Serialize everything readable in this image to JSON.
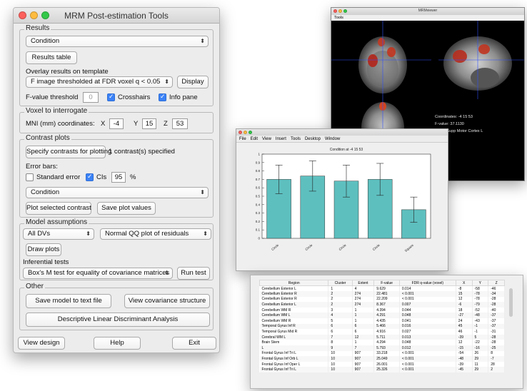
{
  "main": {
    "title": "MRM Post-estimation Tools",
    "results": {
      "group_title": "Results",
      "condition_select": "Condition",
      "results_table_button": "Results table",
      "overlay_label": "Overlay results on template",
      "overlay_select": "F image thresholded at FDR voxel q < 0.05",
      "display_button": "Display",
      "fvalue_label": "F-value threshold",
      "fvalue_value": "0",
      "crosshairs_label": "Crosshairs",
      "info_pane_label": "Info pane"
    },
    "voxel": {
      "group_title": "Voxel to interrogate",
      "mni_label": "MNI (mm) coordinates:",
      "x_label": "X",
      "x_value": "-4",
      "y_label": "Y",
      "y_value": "15",
      "z_label": "Z",
      "z_value": "53"
    },
    "contrast": {
      "group_title": "Contrast plots",
      "specify_button": "Specify contrasts for plotting",
      "specified_text": "1 contrast(s) specified",
      "error_bars_label": "Error bars:",
      "std_error_label": "Standard error",
      "cis_label": "CIs",
      "cis_value": "95",
      "percent": "%",
      "condition_select": "Condition",
      "plot_button": "Plot selected contrast",
      "save_plot_button": "Save plot values"
    },
    "model": {
      "group_title": "Model assumptions",
      "dvs_select": "All DVs",
      "qq_select": "Normal QQ plot of residuals",
      "draw_button": "Draw plots",
      "inferential_label": "Inferential tests",
      "box_select": "Box's M test for equality of covariance matrices",
      "run_button": "Run test"
    },
    "other": {
      "group_title": "Other",
      "save_model_button": "Save model to text file",
      "view_cov_button": "View covariance structure",
      "lda_button": "Descriptive Linear Discriminant Analysis"
    },
    "footer": {
      "view_design_button": "View design",
      "help_button": "Help",
      "exit_button": "Exit"
    }
  },
  "viewer": {
    "title": "MRMviewer",
    "menu": "Tools",
    "coordinates": "Coordinates: -4 15 53",
    "fvalue": "F-value: 37.1130",
    "label": "Label: Supp Motor Cortex L"
  },
  "plot": {
    "menu": [
      "File",
      "Edit",
      "View",
      "Insert",
      "Tools",
      "Desktop",
      "Window"
    ],
    "chart_title": "Condition at -4 15 53",
    "chart_data": {
      "type": "bar",
      "categories": [
        "Circle",
        "Circle",
        "Circle",
        "Circle",
        "Square"
      ],
      "values": [
        0.7,
        0.74,
        0.68,
        0.7,
        0.34
      ],
      "errors": [
        0.17,
        0.18,
        0.19,
        0.19,
        0.15
      ],
      "ylim": [
        0,
        1
      ],
      "yticks": [
        "0",
        "0.1",
        "0.2",
        "0.3",
        "0.4",
        "0.5",
        "0.6",
        "0.7",
        "0.8",
        "0.9",
        "1"
      ],
      "bar_color": "#5ebfbf"
    }
  },
  "table": {
    "headers": [
      "Region",
      "Cluster",
      "Extent",
      "F-value",
      "FDR q-value (voxel)",
      "X",
      "Y",
      "Z"
    ],
    "rows": [
      [
        "Cerebellum Exterior L",
        "1",
        "4",
        "9.629",
        "0.014",
        "-8",
        "-58",
        "-46"
      ],
      [
        "Cerebellum Exterior R",
        "2",
        "274",
        "22.481",
        "< 0.001",
        "15",
        "-78",
        "-34"
      ],
      [
        "Cerebellum Exterior R",
        "2",
        "274",
        "22.209",
        "< 0.001",
        "12",
        "-78",
        "-28"
      ],
      [
        "Cerebellum Exterior L",
        "2",
        "274",
        "8.367",
        "0.007",
        "-6",
        "-79",
        "-28"
      ],
      [
        "Cerebellum WM R",
        "3",
        "1",
        "4.394",
        "0.044",
        "18",
        "-52",
        "-40"
      ],
      [
        "Cerebellum WM L",
        "4",
        "1",
        "4.291",
        "0.048",
        "-27",
        "-48",
        "-37"
      ],
      [
        "Cerebellum WM R",
        "5",
        "1",
        "4.435",
        "0.041",
        "24",
        "-43",
        "-37"
      ],
      [
        "Temporal Gyrus Inf R",
        "6",
        "6",
        "5.466",
        "0.016",
        "45",
        "-1",
        "-37"
      ],
      [
        "Temporal Gyrus Mid R",
        "6",
        "6",
        "4.916",
        "0.027",
        "46",
        "-1",
        "-31"
      ],
      [
        "Cerebral WM L",
        "7",
        "12",
        "5.711",
        "0.013",
        "-39",
        "5",
        "-28"
      ],
      [
        "Brain Stem",
        "8",
        "1",
        "4.294",
        "0.048",
        "12",
        "-22",
        "-28"
      ],
      [
        "L",
        "9",
        "7",
        "5.793",
        "0.012",
        "-15",
        "-16",
        "-25"
      ],
      [
        "Frontal Gyrus Inf Tri L",
        "10",
        "907",
        "33.218",
        "< 0.001",
        "-54",
        "26",
        "8"
      ],
      [
        "Frontal Gyrus Inf Orb L",
        "10",
        "907",
        "25.049",
        "< 0.001",
        "-48",
        "29",
        "-7"
      ],
      [
        "Frontal Gyrus Inf Oper L",
        "10",
        "907",
        "26.001",
        "< 0.001",
        "-39",
        "11",
        "28"
      ],
      [
        "Frontal Gyrus Inf Tri L",
        "10",
        "907",
        "25.326",
        "< 0.001",
        "-45",
        "29",
        "2"
      ]
    ]
  },
  "colors": {
    "close": "#fc605c",
    "minimize": "#fdbc40",
    "zoom": "#34c84a",
    "checkbox": "#3b82f6"
  }
}
